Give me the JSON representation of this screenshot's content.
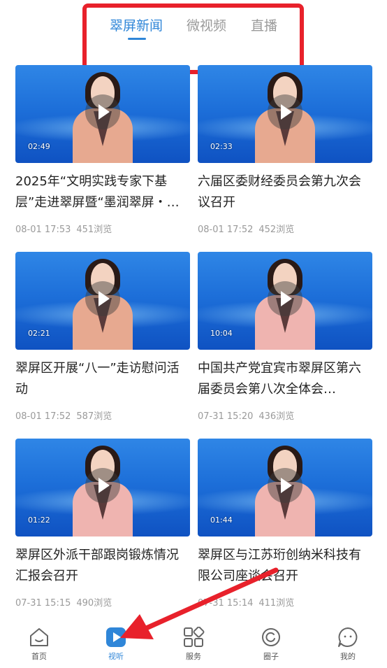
{
  "tabs": [
    {
      "label": "翠屏新闻",
      "active": true
    },
    {
      "label": "微视频",
      "active": false
    },
    {
      "label": "直播",
      "active": false
    }
  ],
  "videos": [
    {
      "title": "2025年“文明实践专家下基层”走进翠屏暨“墨润翠屏・…",
      "date": "08-01 17:53",
      "views": "451浏览",
      "duration": "02:49"
    },
    {
      "title": "六届区委财经委员会第九次会议召开",
      "date": "08-01 17:52",
      "views": "452浏览",
      "duration": "02:33"
    },
    {
      "title": "翠屏区开展“八一”走访慰问活动",
      "date": "08-01 17:52",
      "views": "587浏览",
      "duration": "02:21"
    },
    {
      "title": "中国共产党宜宾市翠屏区第六届委员会第八次全体会…",
      "date": "07-31 15:20",
      "views": "436浏览",
      "duration": "10:04"
    },
    {
      "title": "翠屏区外派干部跟岗锻炼情况汇报会召开",
      "date": "07-31 15:15",
      "views": "490浏览",
      "duration": "01:22"
    },
    {
      "title": "翠屏区与江苏珩创纳米科技有限公司座谈会召开",
      "date": "07-31 15:14",
      "views": "411浏览",
      "duration": "01:44"
    }
  ],
  "bottom_nav": [
    {
      "label": "首页",
      "icon": "home-icon",
      "active": false
    },
    {
      "label": "视听",
      "icon": "play-icon",
      "active": true
    },
    {
      "label": "服务",
      "icon": "grid-icon",
      "active": false
    },
    {
      "label": "圈子",
      "icon": "circle-icon",
      "active": false
    },
    {
      "label": "我的",
      "icon": "profile-icon",
      "active": false
    }
  ],
  "colors": {
    "accent": "#2f86d8",
    "annotation": "#e8212b"
  }
}
